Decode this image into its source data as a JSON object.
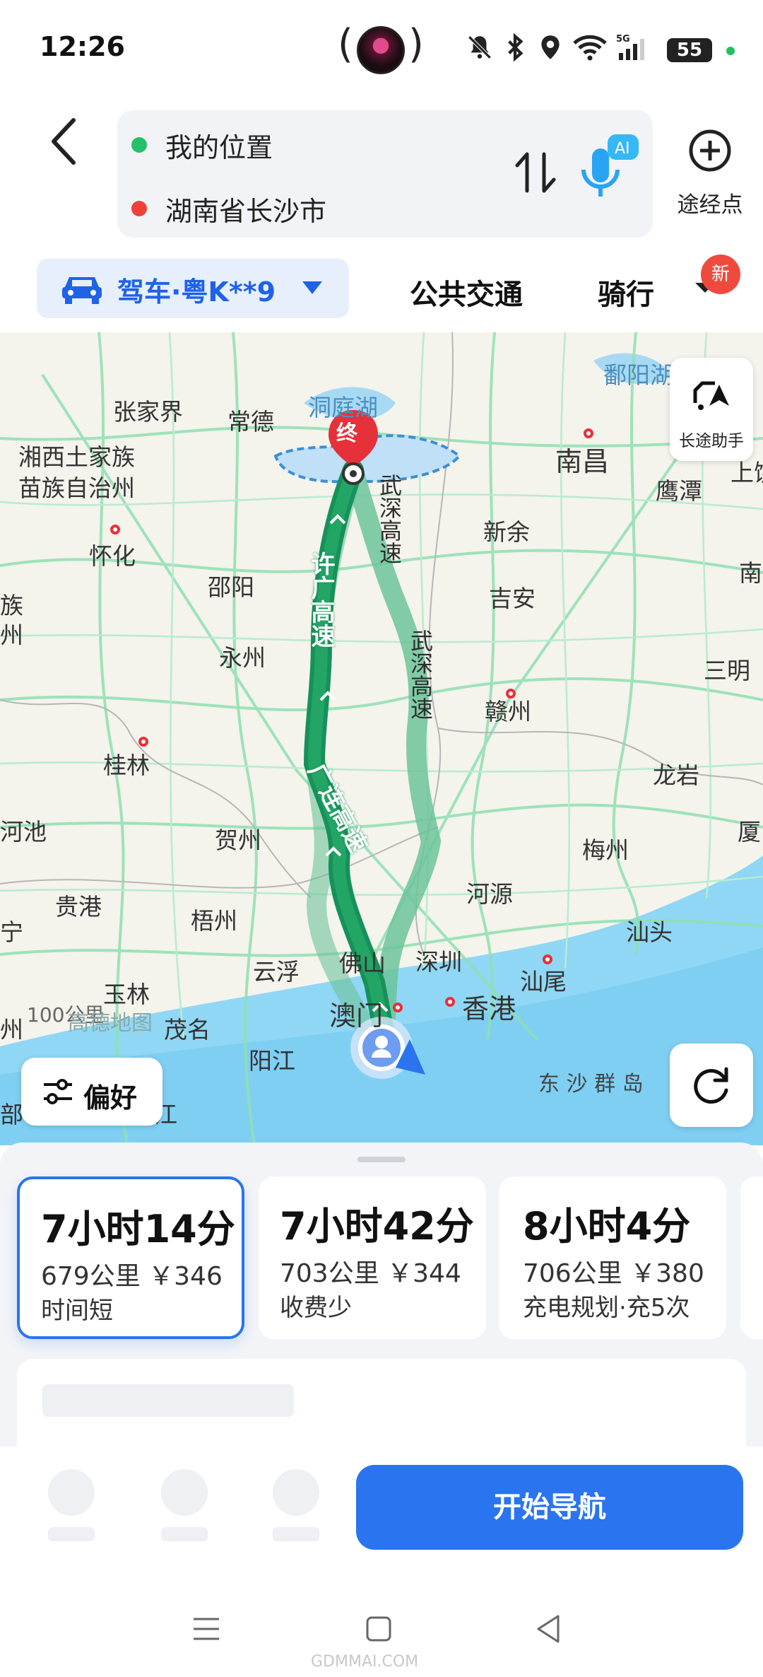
{
  "status_bar": {
    "time": "12:26",
    "signal": "5G",
    "battery": "55"
  },
  "header": {
    "origin": "我的位置",
    "destination": "湖南省长沙市",
    "voice_badge": "AI",
    "waypoint_label": "途经点"
  },
  "modes": {
    "drive_label": "驾车·粤K**9",
    "transit_label": "公共交通",
    "bike_label": "骑行",
    "new_badge": "新"
  },
  "map": {
    "end_marker": "终",
    "long_trip_label": "长途助手",
    "preference_label": "偏好",
    "scale": "100公里",
    "brand": "高德地图",
    "highway_labels": {
      "xuguang": "许广高速",
      "wushen_1": "武深高速",
      "wushen_2": "武深高速",
      "guanglian": "广连高速"
    },
    "places": {
      "zhangjiajie": "张家界",
      "changde": "常德",
      "dongting": "洞庭湖",
      "poyang": "鄱阳湖",
      "nanchang": "南昌",
      "xiangxi_1": "湘西土家族",
      "xiangxi_2": "苗族自治州",
      "yingtan": "鹰潭",
      "shang": "上饶",
      "huaihua": "怀化",
      "shaoyang": "邵阳",
      "xinyu": "新余",
      "ji_an": "吉安",
      "nan": "南平",
      "zu": "族",
      "zhou": "州",
      "yongzhou": "永州",
      "sanming": "三明",
      "ganzhou": "赣州",
      "guilin": "桂林",
      "longyan": "龙岩",
      "hechi": "河池",
      "hezhou": "贺州",
      "meizhou": "梅州",
      "xia": "厦门",
      "heyuan": "河源",
      "guigang": "贵港",
      "wuzhou": "梧州",
      "shantou": "汕头",
      "ning": "宁",
      "yunfu": "云浮",
      "foshan": "佛山",
      "shenzhen": "深圳",
      "shanwei": "汕尾",
      "yulin": "玉林",
      "macau": "澳门",
      "hongkong": "香港",
      "maoming": "茂名",
      "yangjiang": "阳江",
      "zhou2": "州",
      "dongsha": "东 沙 群 岛",
      "bu": "部",
      "jiang": "江"
    }
  },
  "routes": [
    {
      "time": "7小时14分",
      "meta": "679公里 ￥346",
      "tag": "时间短",
      "selected": true
    },
    {
      "time": "7小时42分",
      "meta": "703公里 ￥344",
      "tag": "收费少",
      "selected": false
    },
    {
      "time": "8小时4分",
      "meta": "706公里 ￥380",
      "tag": "充电规划·充5次",
      "selected": false
    }
  ],
  "actions": {
    "start_navigation": "开始导航"
  },
  "footer_watermark": "GDMMAI.COM"
}
